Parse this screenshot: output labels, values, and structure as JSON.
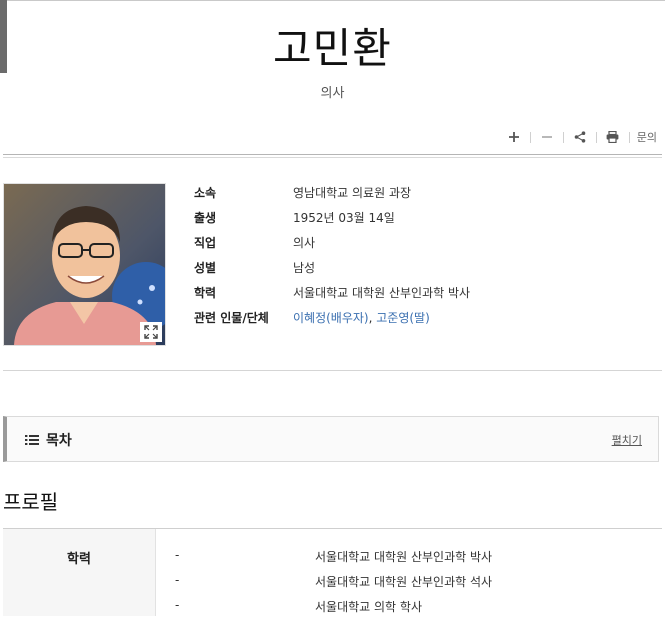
{
  "person": {
    "name": "고민환",
    "occupation_subtitle": "의사"
  },
  "toolbar": {
    "zoom_in": "+",
    "zoom_out": "−",
    "share": "share",
    "print": "print",
    "inquiry_label": "문의"
  },
  "info": {
    "rows": [
      {
        "label": "소속",
        "value": "영남대학교 의료원 과장"
      },
      {
        "label": "출생",
        "value": "1952년 03월 14일"
      },
      {
        "label": "직업",
        "value": "의사"
      },
      {
        "label": "성별",
        "value": "남성"
      },
      {
        "label": "학력",
        "value": "서울대학교 대학원 산부인과학 박사"
      },
      {
        "label": "관련 인물/단체"
      }
    ],
    "related": [
      {
        "text": "이혜정(배우자)"
      },
      {
        "sep": ", "
      },
      {
        "text": "고준영(딸)"
      }
    ]
  },
  "toc": {
    "title": "목차",
    "toggle_label": "펼치기"
  },
  "profile": {
    "section_title": "프로필",
    "education_label": "학력",
    "education": [
      {
        "period": "-",
        "value": "서울대학교 대학원 산부인과학 박사"
      },
      {
        "period": "-",
        "value": "서울대학교 대학원 산부인과학 석사"
      },
      {
        "period": "-",
        "value": "서울대학교 의학 학사"
      }
    ]
  },
  "colors": {
    "link": "#3a6fb0",
    "accent_bar": "#6b6b6b"
  },
  "icons": [
    "plus-icon",
    "minus-icon",
    "share-icon",
    "print-icon",
    "expand-icon",
    "list-icon"
  ]
}
